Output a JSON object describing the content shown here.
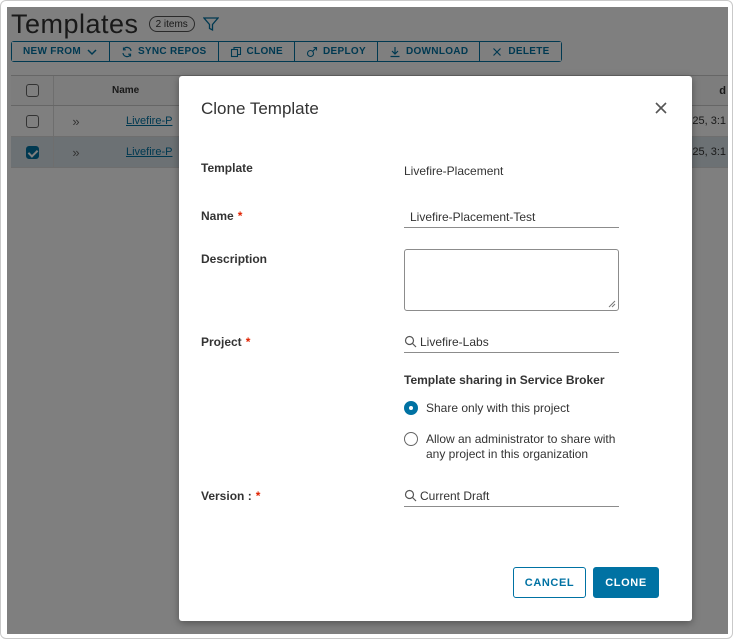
{
  "page": {
    "title": "Templates",
    "count_badge": "2 items"
  },
  "toolbar": {
    "new_from": "NEW FROM",
    "sync_repos": "SYNC REPOS",
    "clone": "CLONE",
    "deploy": "DEPLOY",
    "download": "DOWNLOAD",
    "delete": "DELETE"
  },
  "grid": {
    "header_name": "Name",
    "header_right": "d",
    "rows": [
      {
        "name": "Livefire-P",
        "right": "25, 3:1",
        "selected": false
      },
      {
        "name": "Livefire-P",
        "right": "25, 3:1",
        "selected": true
      }
    ]
  },
  "modal": {
    "title": "Clone Template",
    "template_label": "Template",
    "template_value": "Livefire-Placement",
    "name_label": "Name",
    "name_value": "Livefire-Placement-Test",
    "description_label": "Description",
    "description_value": "",
    "project_label": "Project",
    "project_value": "Livefire-Labs",
    "sharing_title": "Template sharing in Service Broker",
    "sharing_option_1": "Share only with this project",
    "sharing_option_2": "Allow an administrator to share with any project in this organization",
    "sharing_selected": 1,
    "version_label": "Version :",
    "version_value": "Current Draft",
    "required_marker": "*",
    "cancel_label": "CANCEL",
    "clone_label": "CLONE"
  },
  "colors": {
    "accent": "#0072a3",
    "required": "#e12200",
    "selected_row": "#d8e3e9"
  }
}
